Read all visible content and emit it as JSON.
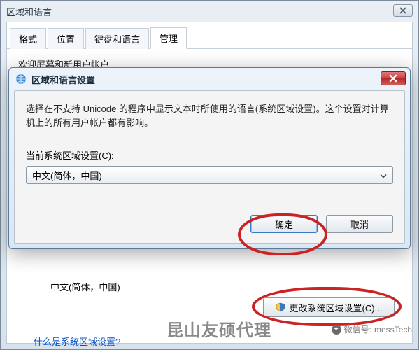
{
  "background_window": {
    "title": "区域和语言",
    "tabs": [
      "格式",
      "位置",
      "键盘和语言",
      "管理"
    ],
    "active_tab_index": 3,
    "truncated_section_text": "欢迎屏幕和新用户帐户"
  },
  "modal": {
    "title": "区域和语言设置",
    "description": "选择在不支持 Unicode 的程序中显示文本时所使用的语言(系统区域设置)。这个设置对计算机上的所有用户帐户都有影响。",
    "combo_label": "当前系统区域设置(C):",
    "combo_value": "中文(简体，中国)",
    "ok_label": "确定",
    "cancel_label": "取消"
  },
  "lower": {
    "current_locale_text": "中文(简体，中国)",
    "change_button_label": "更改系统区域设置(C)...",
    "help_link": "什么是系统区域设置?"
  },
  "watermark": {
    "text1": "昆山友硕代理",
    "text2_prefix": "微信号:",
    "text2_value": "messTech"
  }
}
